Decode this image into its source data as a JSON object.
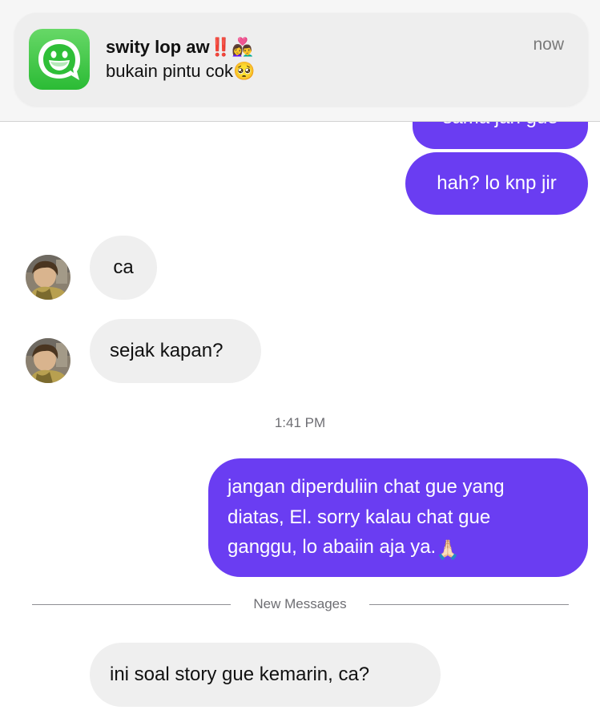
{
  "notification": {
    "sender": "swity lop aw",
    "sender_emoji_1": "‼️",
    "sender_emoji_2": "👩‍❤️‍👨",
    "message": "bukain pintu cok",
    "message_emoji": "🥺",
    "time": "now",
    "app_icon": "smiling-chat-bubble-icon",
    "app_color": "#3cc33f"
  },
  "messages": {
    "partial_out": "sama jan gue",
    "hah": "hah? lo knp jir",
    "ca": "ca",
    "sejak": "sejak kapan?",
    "timestamp": "1:41 PM",
    "long_line1": "jangan diperduliin chat gue yang",
    "long_line2": "diatas, El. sorry kalau chat gue",
    "long_line3": "ganggu, lo abaiin aja ya.",
    "long_emoji": "🙏🏻",
    "new_messages_label": "New Messages",
    "last_in": "ini soal story gue kemarin, ca?"
  },
  "colors": {
    "outgoing": "#6a3df2",
    "outgoing_gradient_end": "#4f4cee",
    "incoming": "#efefef"
  }
}
